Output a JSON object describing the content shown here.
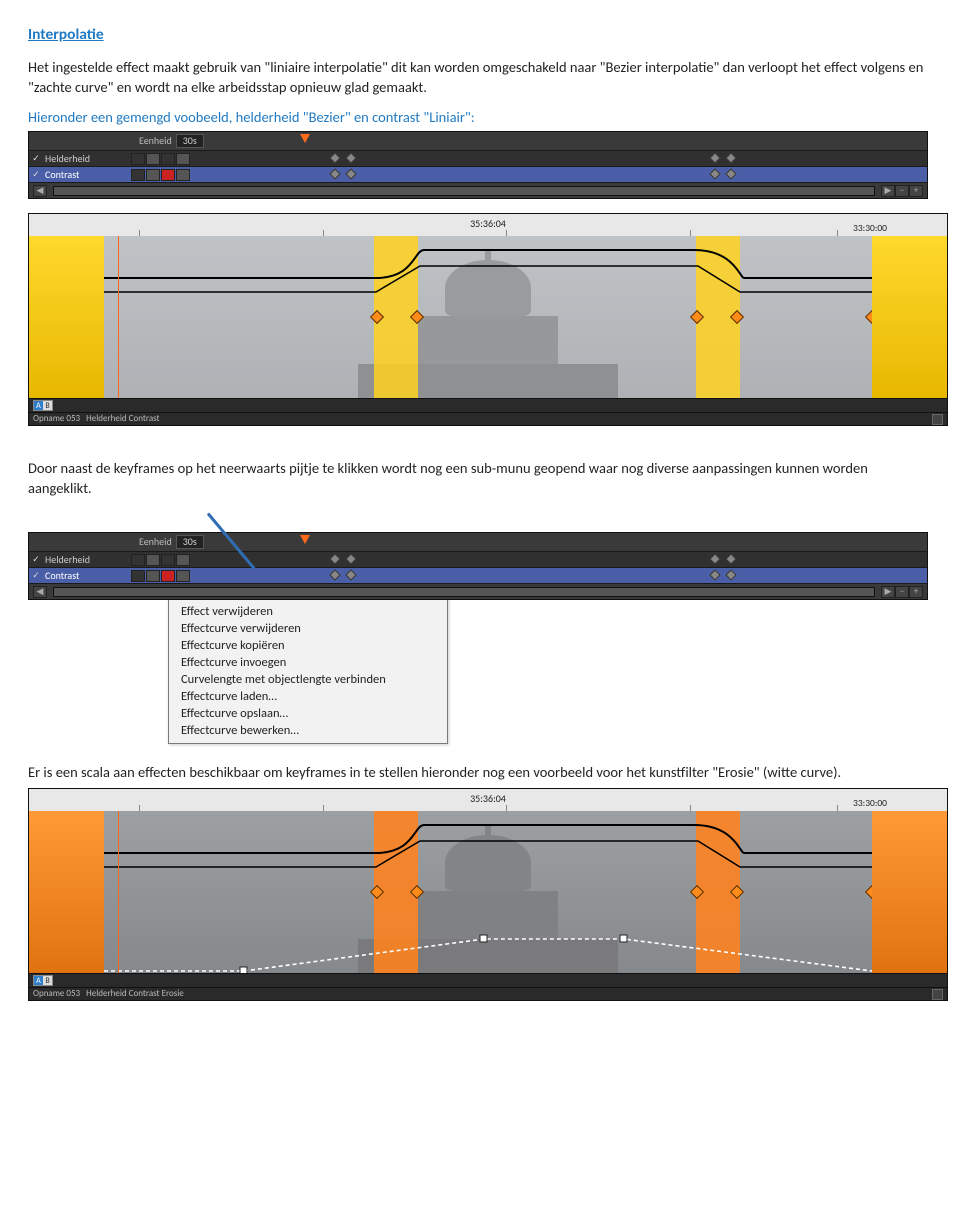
{
  "title": "Interpolatie",
  "para1": "Het ingestelde effect maakt gebruik van \"liniaire interpolatie\" dit kan worden omgeschakeld naar \"Bezier interpolatie\" dan verloopt het effect volgens en \"zachte curve\" en wordt na elke arbeidsstap opnieuw glad gemaakt.",
  "caption1": "Hieronder een gemengd voobeeld, helderheid \"Bezier\" en contrast \"Liniair\":",
  "panel": {
    "eenheid_label": "Eenheid",
    "eenheid_value": "30s",
    "effects": [
      "Helderheid",
      "Contrast"
    ]
  },
  "timeline": {
    "timecode_center": "35:36:04",
    "timecode_right": "33:30:00",
    "footer_clip": "Opname 053",
    "footer_effects_a": "Helderheid  Contrast",
    "footer_effects_b": "Helderheid  Contrast  Erosie",
    "ab": {
      "a": "A",
      "b": "B"
    }
  },
  "para2": "Door naast de keyframes op het neerwaarts pijtje te klikken wordt nog een sub-munu geopend waar nog diverse aanpassingen kunnen worden aangeklikt.",
  "panel2": {
    "eenheid_label": "Eenheid",
    "eenheid_value": "30s",
    "effects": [
      "Helderheid",
      "Contrast"
    ]
  },
  "menu": {
    "items": [
      "Effect verwijderen",
      "Effectcurve verwijderen",
      "Effectcurve kopiëren",
      "Effectcurve invoegen",
      "Curvelengte met objectlengte verbinden",
      "Effectcurve laden…",
      "Effectcurve opslaan…",
      "Effectcurve bewerken…"
    ]
  },
  "para3": "Er is een scala aan effecten beschikbaar om keyframes in te stellen hieronder nog een voorbeeld voor het kunstfilter \"Erosie\"   (witte curve)."
}
